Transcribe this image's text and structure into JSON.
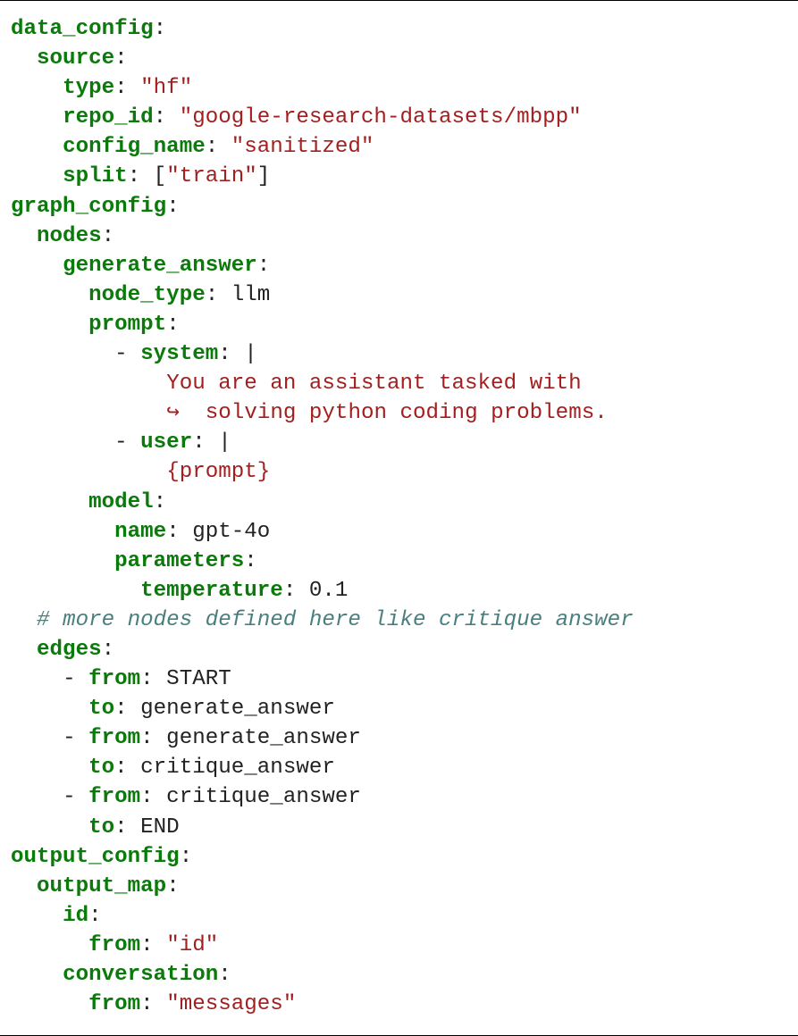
{
  "colors": {
    "key": "#0a7a0a",
    "string": "#a31f1f",
    "comment": "#4a7f80",
    "plain": "#222222"
  },
  "lines": [
    {
      "indent": "",
      "segments": [
        {
          "t": "key",
          "v": "data_config"
        },
        {
          "t": "plain",
          "v": ":"
        }
      ]
    },
    {
      "indent": "  ",
      "segments": [
        {
          "t": "key",
          "v": "source"
        },
        {
          "t": "plain",
          "v": ":"
        }
      ]
    },
    {
      "indent": "    ",
      "segments": [
        {
          "t": "key",
          "v": "type"
        },
        {
          "t": "plain",
          "v": ": "
        },
        {
          "t": "str",
          "v": "\"hf\""
        }
      ]
    },
    {
      "indent": "    ",
      "segments": [
        {
          "t": "key",
          "v": "repo_id"
        },
        {
          "t": "plain",
          "v": ": "
        },
        {
          "t": "str",
          "v": "\"google-research-datasets/mbpp\""
        }
      ]
    },
    {
      "indent": "    ",
      "segments": [
        {
          "t": "key",
          "v": "config_name"
        },
        {
          "t": "plain",
          "v": ": "
        },
        {
          "t": "str",
          "v": "\"sanitized\""
        }
      ]
    },
    {
      "indent": "    ",
      "segments": [
        {
          "t": "key",
          "v": "split"
        },
        {
          "t": "plain",
          "v": ": ["
        },
        {
          "t": "str",
          "v": "\"train\""
        },
        {
          "t": "plain",
          "v": "]"
        }
      ]
    },
    {
      "indent": "",
      "segments": [
        {
          "t": "key",
          "v": "graph_config"
        },
        {
          "t": "plain",
          "v": ":"
        }
      ]
    },
    {
      "indent": "  ",
      "segments": [
        {
          "t": "key",
          "v": "nodes"
        },
        {
          "t": "plain",
          "v": ":"
        }
      ]
    },
    {
      "indent": "    ",
      "segments": [
        {
          "t": "key",
          "v": "generate_answer"
        },
        {
          "t": "plain",
          "v": ":"
        }
      ]
    },
    {
      "indent": "      ",
      "segments": [
        {
          "t": "key",
          "v": "node_type"
        },
        {
          "t": "plain",
          "v": ": llm"
        }
      ]
    },
    {
      "indent": "      ",
      "segments": [
        {
          "t": "key",
          "v": "prompt"
        },
        {
          "t": "plain",
          "v": ":"
        }
      ]
    },
    {
      "indent": "        ",
      "segments": [
        {
          "t": "plain",
          "v": "- "
        },
        {
          "t": "key",
          "v": "system"
        },
        {
          "t": "plain",
          "v": ": |"
        }
      ]
    },
    {
      "indent": "            ",
      "segments": [
        {
          "t": "str",
          "v": "You are an assistant tasked with"
        }
      ]
    },
    {
      "indent": "            ",
      "segments": [
        {
          "t": "arrow",
          "v": "↪"
        },
        {
          "t": "str",
          "v": "  solving python coding problems."
        }
      ]
    },
    {
      "indent": "        ",
      "segments": [
        {
          "t": "plain",
          "v": "- "
        },
        {
          "t": "key",
          "v": "user"
        },
        {
          "t": "plain",
          "v": ": |"
        }
      ]
    },
    {
      "indent": "            ",
      "segments": [
        {
          "t": "str",
          "v": "{prompt}"
        }
      ]
    },
    {
      "indent": "      ",
      "segments": [
        {
          "t": "key",
          "v": "model"
        },
        {
          "t": "plain",
          "v": ":"
        }
      ]
    },
    {
      "indent": "        ",
      "segments": [
        {
          "t": "key",
          "v": "name"
        },
        {
          "t": "plain",
          "v": ": gpt-4o"
        }
      ]
    },
    {
      "indent": "        ",
      "segments": [
        {
          "t": "key",
          "v": "parameters"
        },
        {
          "t": "plain",
          "v": ":"
        }
      ]
    },
    {
      "indent": "          ",
      "segments": [
        {
          "t": "key",
          "v": "temperature"
        },
        {
          "t": "plain",
          "v": ": 0.1"
        }
      ]
    },
    {
      "indent": "  ",
      "segments": [
        {
          "t": "cmt",
          "v": "# more nodes defined here like critique answer"
        }
      ]
    },
    {
      "indent": "  ",
      "segments": [
        {
          "t": "key",
          "v": "edges"
        },
        {
          "t": "plain",
          "v": ":"
        }
      ]
    },
    {
      "indent": "    ",
      "segments": [
        {
          "t": "plain",
          "v": "- "
        },
        {
          "t": "key",
          "v": "from"
        },
        {
          "t": "plain",
          "v": ": START"
        }
      ]
    },
    {
      "indent": "      ",
      "segments": [
        {
          "t": "key",
          "v": "to"
        },
        {
          "t": "plain",
          "v": ": generate_answer"
        }
      ]
    },
    {
      "indent": "    ",
      "segments": [
        {
          "t": "plain",
          "v": "- "
        },
        {
          "t": "key",
          "v": "from"
        },
        {
          "t": "plain",
          "v": ": generate_answer"
        }
      ]
    },
    {
      "indent": "      ",
      "segments": [
        {
          "t": "key",
          "v": "to"
        },
        {
          "t": "plain",
          "v": ": critique_answer"
        }
      ]
    },
    {
      "indent": "    ",
      "segments": [
        {
          "t": "plain",
          "v": "- "
        },
        {
          "t": "key",
          "v": "from"
        },
        {
          "t": "plain",
          "v": ": critique_answer"
        }
      ]
    },
    {
      "indent": "      ",
      "segments": [
        {
          "t": "key",
          "v": "to"
        },
        {
          "t": "plain",
          "v": ": END"
        }
      ]
    },
    {
      "indent": "",
      "segments": [
        {
          "t": "key",
          "v": "output_config"
        },
        {
          "t": "plain",
          "v": ":"
        }
      ]
    },
    {
      "indent": "  ",
      "segments": [
        {
          "t": "key",
          "v": "output_map"
        },
        {
          "t": "plain",
          "v": ":"
        }
      ]
    },
    {
      "indent": "    ",
      "segments": [
        {
          "t": "key",
          "v": "id"
        },
        {
          "t": "plain",
          "v": ":"
        }
      ]
    },
    {
      "indent": "      ",
      "segments": [
        {
          "t": "key",
          "v": "from"
        },
        {
          "t": "plain",
          "v": ": "
        },
        {
          "t": "str",
          "v": "\"id\""
        }
      ]
    },
    {
      "indent": "    ",
      "segments": [
        {
          "t": "key",
          "v": "conversation"
        },
        {
          "t": "plain",
          "v": ":"
        }
      ]
    },
    {
      "indent": "      ",
      "segments": [
        {
          "t": "key",
          "v": "from"
        },
        {
          "t": "plain",
          "v": ": "
        },
        {
          "t": "str",
          "v": "\"messages\""
        }
      ]
    }
  ]
}
